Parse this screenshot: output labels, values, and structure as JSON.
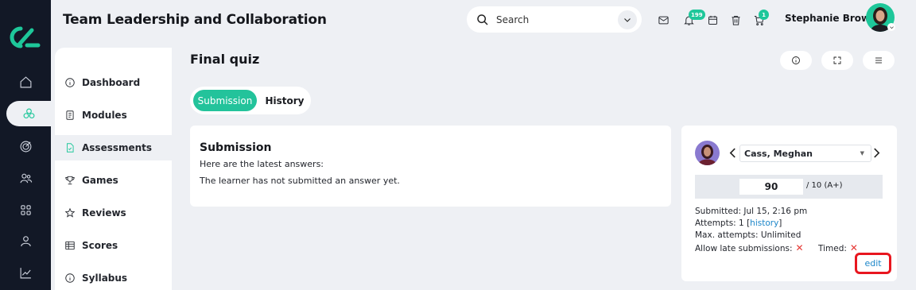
{
  "header": {
    "course_title": "Team Leadership and Collaboration",
    "search_placeholder": "Search",
    "notifications_badge": "199",
    "cart_badge": "1",
    "user_name": "Stephanie Brown"
  },
  "rail": {
    "icons": [
      "home-icon",
      "courses-icon",
      "target-icon",
      "users-icon",
      "grid-icon",
      "person-icon",
      "chart-icon"
    ],
    "active_index": 1
  },
  "menu": {
    "items": [
      {
        "label": "Dashboard",
        "icon": "info-icon"
      },
      {
        "label": "Modules",
        "icon": "book-icon"
      },
      {
        "label": "Assessments",
        "icon": "document-icon",
        "active": true
      },
      {
        "label": "Games",
        "icon": "trophy-icon"
      },
      {
        "label": "Reviews",
        "icon": "star-icon"
      },
      {
        "label": "Scores",
        "icon": "table-icon"
      },
      {
        "label": "Syllabus",
        "icon": "info-icon"
      }
    ]
  },
  "main": {
    "section_title": "Final quiz",
    "tabs": [
      {
        "label": "Submission",
        "active": true
      },
      {
        "label": "History",
        "active": false
      }
    ],
    "submission": {
      "title": "Submission",
      "line1": "Here are the latest answers:",
      "line2": "The learner has not submitted an answer yet."
    }
  },
  "grading": {
    "learner_name": "Cass, Meghan",
    "grade_value": "90",
    "grade_max": "/ 10 (A+)",
    "submitted": "Submitted: Jul 15, 2:16 pm",
    "attempts_prefix": "Attempts: 1 [",
    "attempts_link": "history",
    "attempts_suffix": "]",
    "max_attempts": "Max. attempts: Unlimited",
    "allow_late_label": "Allow late submissions:",
    "timed_label": "Timed:",
    "x_glyph": "✕",
    "edit_label": "edit"
  },
  "colors": {
    "accent": "#1ec79a",
    "rail_bg": "#121826",
    "link": "#1c86c9",
    "highlight_border": "#e8161f"
  }
}
